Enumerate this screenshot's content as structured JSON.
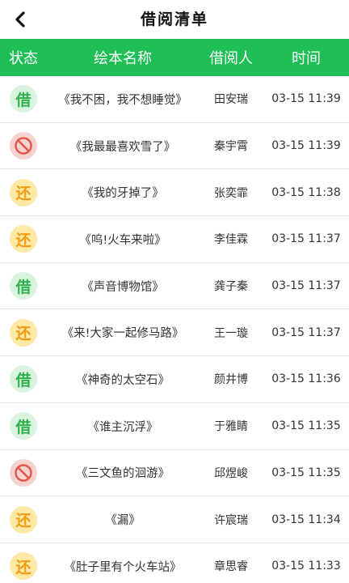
{
  "nav": {
    "title": "借阅清单"
  },
  "table": {
    "headers": {
      "status": "状态",
      "title": "绘本名称",
      "borrower": "借阅人",
      "time": "时间"
    },
    "rows": [
      {
        "status": "borrow",
        "status_label": "借",
        "title": "《我不困，我不想睡觉》",
        "borrower": "田安瑞",
        "time": "03-15 11:39"
      },
      {
        "status": "denied",
        "status_label": "",
        "title": "《我最最喜欢雪了》",
        "borrower": "秦宇霄",
        "time": "03-15 11:39"
      },
      {
        "status": "return",
        "status_label": "还",
        "title": "《我的牙掉了》",
        "borrower": "张奕霏",
        "time": "03-15 11:38"
      },
      {
        "status": "return",
        "status_label": "还",
        "title": "《呜!火车来啦》",
        "borrower": "李佳霖",
        "time": "03-15 11:37"
      },
      {
        "status": "borrow",
        "status_label": "借",
        "title": "《声音博物馆》",
        "borrower": "龚子秦",
        "time": "03-15 11:37"
      },
      {
        "status": "return",
        "status_label": "还",
        "title": "《来!大家一起修马路》",
        "borrower": "王一璇",
        "time": "03-15 11:37"
      },
      {
        "status": "borrow",
        "status_label": "借",
        "title": "《神奇的太空石》",
        "borrower": "颜井博",
        "time": "03-15 11:36"
      },
      {
        "status": "borrow",
        "status_label": "借",
        "title": "《谁主沉浮》",
        "borrower": "于雅睛",
        "time": "03-15 11:35"
      },
      {
        "status": "denied",
        "status_label": "",
        "title": "《三文鱼的洄游》",
        "borrower": "邱煜峻",
        "time": "03-15 11:35"
      },
      {
        "status": "return",
        "status_label": "还",
        "title": "《漏》",
        "borrower": "许宸瑞",
        "time": "03-15 11:34"
      },
      {
        "status": "return",
        "status_label": "还",
        "title": "《肚子里有个火车站》",
        "borrower": "章思睿",
        "time": "03-15 11:33"
      }
    ]
  },
  "colors": {
    "header_green": "#1fbf55",
    "borrow_green": "#2fb24f",
    "return_orange": "#f39c12",
    "denied_red": "#e2574c"
  },
  "icons": {
    "back": "chevron-left-icon",
    "denied": "prohibited-icon"
  }
}
